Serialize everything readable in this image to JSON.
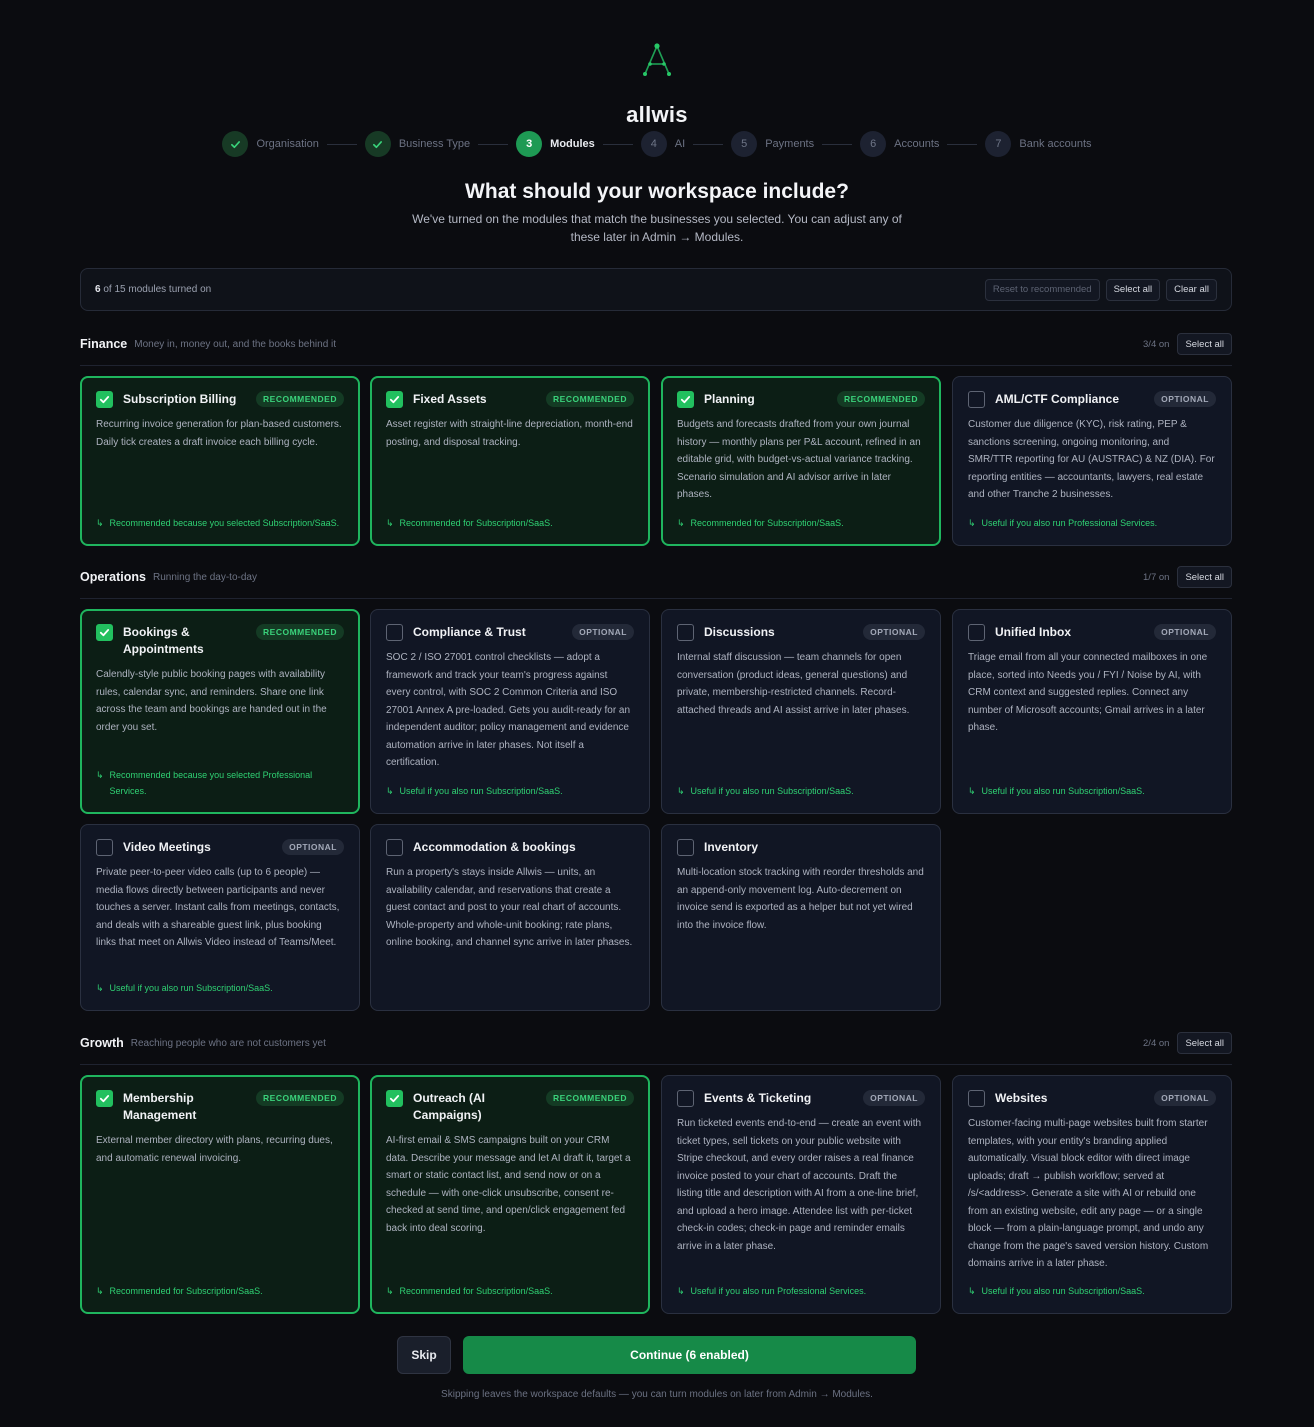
{
  "brand": {
    "name": "allwis",
    "logo_icon": "tripod-network-icon",
    "accent": "#22c05f"
  },
  "stepper": [
    {
      "num": "1",
      "label": "Organisation",
      "state": "done"
    },
    {
      "num": "2",
      "label": "Business Type",
      "state": "done"
    },
    {
      "num": "3",
      "label": "Modules",
      "state": "active"
    },
    {
      "num": "4",
      "label": "AI",
      "state": "todo"
    },
    {
      "num": "5",
      "label": "Payments",
      "state": "todo"
    },
    {
      "num": "6",
      "label": "Accounts",
      "state": "todo"
    },
    {
      "num": "7",
      "label": "Bank accounts",
      "state": "todo"
    }
  ],
  "heading": "What should your workspace include?",
  "subheading": "We've turned on the modules that match the businesses you selected. You can adjust any of these later in Admin → Modules.",
  "countbar": {
    "count_number": "6",
    "count_rest": " of 15 modules turned on",
    "reset_label": "Reset to recommended",
    "select_all_label": "Select all",
    "clear_all_label": "Clear all"
  },
  "sections": [
    {
      "title": "Finance",
      "desc": "Money in, money out, and the books behind it",
      "on_count": "3/4 on",
      "select_all": "Select all",
      "cards": [
        {
          "title": "Subscription Billing",
          "checked": true,
          "badge": "RECOMMENDED",
          "desc": "Recurring invoice generation for plan-based customers. Daily tick creates a draft invoice each billing cycle.",
          "note": "Recommended because you selected Subscription/SaaS."
        },
        {
          "title": "Fixed Assets",
          "checked": true,
          "badge": "RECOMMENDED",
          "desc": "Asset register with straight-line depreciation, month-end posting, and disposal tracking.",
          "note": "Recommended for Subscription/SaaS."
        },
        {
          "title": "Planning",
          "checked": true,
          "badge": "RECOMMENDED",
          "desc": "Budgets and forecasts drafted from your own journal history — monthly plans per P&L account, refined in an editable grid, with budget-vs-actual variance tracking. Scenario simulation and AI advisor arrive in later phases.",
          "note": "Recommended for Subscription/SaaS."
        },
        {
          "title": "AML/CTF Compliance",
          "checked": false,
          "badge": "OPTIONAL",
          "desc": "Customer due diligence (KYC), risk rating, PEP & sanctions screening, ongoing monitoring, and SMR/TTR reporting for AU (AUSTRAC) & NZ (DIA). For reporting entities — accountants, lawyers, real estate and other Tranche 2 businesses.",
          "note": "Useful if you also run Professional Services."
        }
      ]
    },
    {
      "title": "Operations",
      "desc": "Running the day-to-day",
      "on_count": "1/7 on",
      "select_all": "Select all",
      "cards": [
        {
          "title": "Bookings & Appointments",
          "checked": true,
          "badge": "RECOMMENDED",
          "desc": "Calendly-style public booking pages with availability rules, calendar sync, and reminders. Share one link across the team and bookings are handed out in the order you set.",
          "note": "Recommended because you selected Professional Services."
        },
        {
          "title": "Compliance & Trust",
          "checked": false,
          "badge": "OPTIONAL",
          "desc": "SOC 2 / ISO 27001 control checklists — adopt a framework and track your team's progress against every control, with SOC 2 Common Criteria and ISO 27001 Annex A pre-loaded. Gets you audit-ready for an independent auditor; policy management and evidence automation arrive in later phases. Not itself a certification.",
          "note": "Useful if you also run Subscription/SaaS."
        },
        {
          "title": "Discussions",
          "checked": false,
          "badge": "OPTIONAL",
          "desc": "Internal staff discussion — team channels for open conversation (product ideas, general questions) and private, membership-restricted channels. Record-attached threads and AI assist arrive in later phases.",
          "note": "Useful if you also run Subscription/SaaS."
        },
        {
          "title": "Unified Inbox",
          "checked": false,
          "badge": "OPTIONAL",
          "desc": "Triage email from all your connected mailboxes in one place, sorted into Needs you / FYI / Noise by AI, with CRM context and suggested replies. Connect any number of Microsoft accounts; Gmail arrives in a later phase.",
          "note": "Useful if you also run Subscription/SaaS."
        },
        {
          "title": "Video Meetings",
          "checked": false,
          "badge": "OPTIONAL",
          "desc": "Private peer-to-peer video calls (up to 6 people) — media flows directly between participants and never touches a server. Instant calls from meetings, contacts, and deals with a shareable guest link, plus booking links that meet on Allwis Video instead of Teams/Meet.",
          "note": "Useful if you also run Subscription/SaaS."
        },
        {
          "title": "Accommodation & bookings",
          "checked": false,
          "badge": "",
          "desc": "Run a property's stays inside Allwis — units, an availability calendar, and reservations that create a guest contact and post to your real chart of accounts. Whole-property and whole-unit booking; rate plans, online booking, and channel sync arrive in later phases.",
          "note": ""
        },
        {
          "title": "Inventory",
          "checked": false,
          "badge": "",
          "desc": "Multi-location stock tracking with reorder thresholds and an append-only movement log. Auto-decrement on invoice send is exported as a helper but not yet wired into the invoice flow.",
          "note": ""
        }
      ]
    },
    {
      "title": "Growth",
      "desc": "Reaching people who are not customers yet",
      "on_count": "2/4 on",
      "select_all": "Select all",
      "cards": [
        {
          "title": "Membership Management",
          "checked": true,
          "badge": "RECOMMENDED",
          "desc": "External member directory with plans, recurring dues, and automatic renewal invoicing.",
          "note": "Recommended for Subscription/SaaS."
        },
        {
          "title": "Outreach (AI Campaigns)",
          "checked": true,
          "badge": "RECOMMENDED",
          "desc": "AI-first email & SMS campaigns built on your CRM data. Describe your message and let AI draft it, target a smart or static contact list, and send now or on a schedule — with one-click unsubscribe, consent re-checked at send time, and open/click engagement fed back into deal scoring.",
          "note": "Recommended for Subscription/SaaS."
        },
        {
          "title": "Events & Ticketing",
          "checked": false,
          "badge": "OPTIONAL",
          "desc": "Run ticketed events end-to-end — create an event with ticket types, sell tickets on your public website with Stripe checkout, and every order raises a real finance invoice posted to your chart of accounts. Draft the listing title and description with AI from a one-line brief, and upload a hero image. Attendee list with per-ticket check-in codes; check-in page and reminder emails arrive in a later phase.",
          "note": "Useful if you also run Professional Services."
        },
        {
          "title": "Websites",
          "checked": false,
          "badge": "OPTIONAL",
          "desc": "Customer-facing multi-page websites built from starter templates, with your entity's branding applied automatically. Visual block editor with direct image uploads; draft → publish workflow; served at /s/<address>. Generate a site with AI or rebuild one from an existing website, edit any page — or a single block — from a plain-language prompt, and undo any change from the page's saved version history. Custom domains arrive in a later phase.",
          "note": "Useful if you also run Subscription/SaaS."
        }
      ]
    }
  ],
  "footer": {
    "skip_label": "Skip",
    "continue_label": "Continue (6 enabled)",
    "note": "Skipping leaves the workspace defaults — you can turn modules on later from Admin → Modules."
  }
}
